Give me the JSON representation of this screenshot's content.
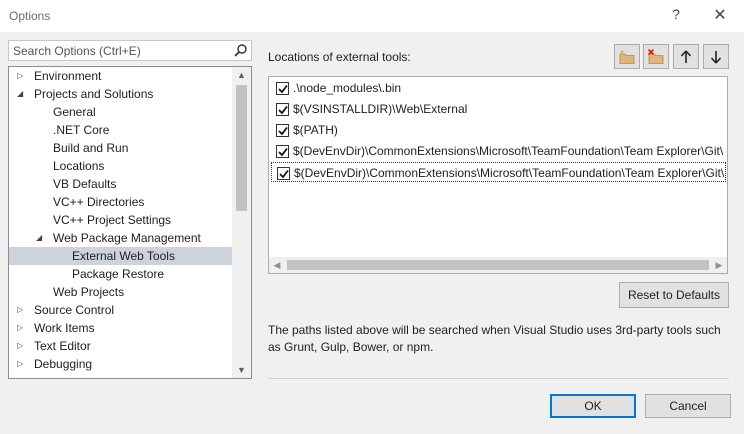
{
  "window": {
    "title": "Options",
    "help_glyph": "?",
    "close_glyph": "✕"
  },
  "search": {
    "placeholder": "Search Options (Ctrl+E)"
  },
  "tree": {
    "items": [
      {
        "label": "Environment",
        "expander": "▷"
      },
      {
        "label": "Projects and Solutions",
        "expander": "◢"
      },
      {
        "label": "General"
      },
      {
        "label": ".NET Core"
      },
      {
        "label": "Build and Run"
      },
      {
        "label": "Locations"
      },
      {
        "label": "VB Defaults"
      },
      {
        "label": "VC++ Directories"
      },
      {
        "label": "VC++ Project Settings"
      },
      {
        "label": "Web Package Management",
        "expander": "◢"
      },
      {
        "label": "External Web Tools",
        "selected": true
      },
      {
        "label": "Package Restore"
      },
      {
        "label": "Web Projects"
      },
      {
        "label": "Source Control",
        "expander": "▷"
      },
      {
        "label": "Work Items",
        "expander": "▷"
      },
      {
        "label": "Text Editor",
        "expander": "▷"
      },
      {
        "label": "Debugging",
        "expander": "▷"
      }
    ]
  },
  "panel": {
    "label": "Locations of external tools:",
    "toolbar": {
      "add_icon": "add-folder-icon",
      "remove_icon": "remove-folder-icon",
      "up_icon": "arrow-up-icon",
      "down_icon": "arrow-down-icon"
    },
    "paths": [
      {
        "text": ".\\node_modules\\.bin",
        "checked": true
      },
      {
        "text": "$(VSINSTALLDIR)\\Web\\External",
        "checked": true
      },
      {
        "text": "$(PATH)",
        "checked": true
      },
      {
        "text": "$(DevEnvDir)\\CommonExtensions\\Microsoft\\TeamFoundation\\Team Explorer\\Git\\",
        "checked": true
      },
      {
        "text": "$(DevEnvDir)\\CommonExtensions\\Microsoft\\TeamFoundation\\Team Explorer\\Git\\",
        "checked": true,
        "focused": true
      }
    ],
    "reset_label": "Reset to Defaults",
    "description": "The paths listed above will be searched when Visual Studio uses 3rd-party tools such as Grunt, Gulp, Bower, or npm."
  },
  "footer": {
    "ok_label": "OK",
    "cancel_label": "Cancel"
  },
  "colors": {
    "accent": "#0078d7",
    "selection": "#cdd2db",
    "folder": "#dcb67a",
    "remove": "#e51400"
  }
}
